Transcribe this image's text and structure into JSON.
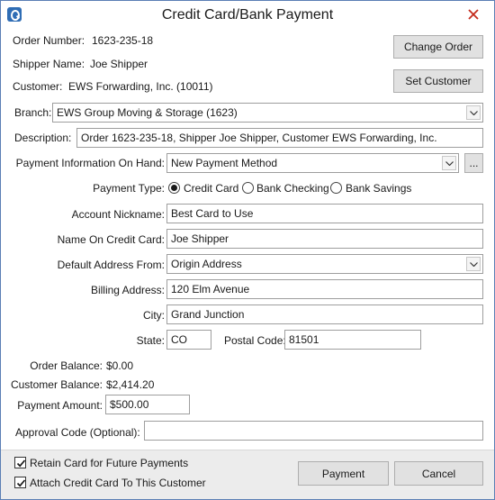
{
  "window": {
    "title": "Credit Card/Bank Payment"
  },
  "info": {
    "order_number_label": "Order Number:",
    "order_number": "1623-235-18",
    "shipper_name_label": "Shipper Name:",
    "shipper_name": "Joe Shipper",
    "customer_label": "Customer:",
    "customer": "EWS Forwarding, Inc. (10011)"
  },
  "buttons": {
    "change_order": "Change Order",
    "set_customer": "Set Customer",
    "ellipsis": "...",
    "payment": "Payment",
    "cancel": "Cancel"
  },
  "branch": {
    "label": "Branch:",
    "value": "EWS Group Moving & Storage (1623)"
  },
  "description": {
    "label": "Description:",
    "value": "Order 1623-235-18, Shipper Joe Shipper, Customer EWS Forwarding, Inc."
  },
  "payment_info": {
    "label": "Payment Information On Hand:",
    "value": "New Payment Method"
  },
  "payment_type": {
    "label": "Payment Type:",
    "options": [
      "Credit Card",
      "Bank Checking",
      "Bank Savings"
    ],
    "selected": "Credit Card"
  },
  "account_nickname": {
    "label": "Account Nickname:",
    "value": "Best Card to Use"
  },
  "name_on_card": {
    "label": "Name On Credit Card:",
    "value": "Joe Shipper"
  },
  "default_address": {
    "label": "Default Address From:",
    "value": "Origin Address"
  },
  "billing_address": {
    "label": "Billing Address:",
    "value": "120 Elm Avenue"
  },
  "city": {
    "label": "City:",
    "value": "Grand Junction"
  },
  "state": {
    "label": "State:",
    "value": "CO"
  },
  "postal_code": {
    "label": "Postal Code:",
    "value": "81501"
  },
  "balances": {
    "order_balance_label": "Order Balance:",
    "order_balance": "$0.00",
    "customer_balance_label": "Customer Balance:",
    "customer_balance": "$2,414.20"
  },
  "payment_amount": {
    "label": "Payment Amount:",
    "value": "$500.00"
  },
  "approval_code": {
    "label": "Approval Code (Optional):",
    "value": ""
  },
  "checkboxes": {
    "retain_card": {
      "label": "Retain Card for Future Payments",
      "checked": true
    },
    "attach_card": {
      "label": "Attach Credit Card To This Customer",
      "checked": true
    }
  },
  "colors": {
    "accent": "#2f6db5",
    "close_icon": "#c42b1c",
    "footer_bg": "#ececec"
  },
  "icons": {
    "app": "app-icon",
    "close": "close-icon",
    "dropdown": "chevron-down-icon",
    "check": "checkmark-icon"
  }
}
